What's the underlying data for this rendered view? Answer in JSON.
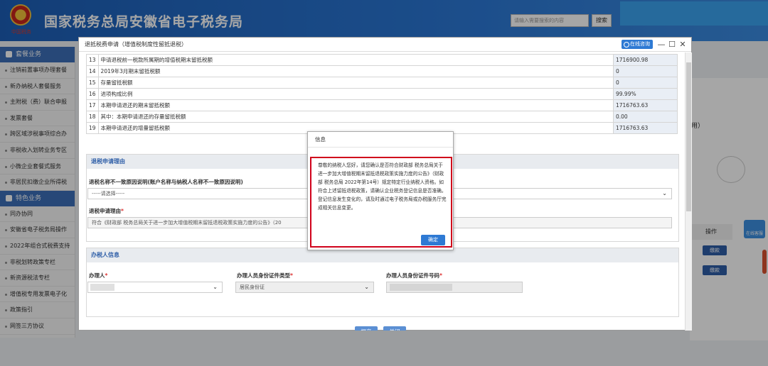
{
  "header": {
    "site_title": "国家税务总局安徽省电子税务局",
    "emblem_caption": "中国税务",
    "search_placeholder": "请输入需要搜索的内容",
    "search_label": "搜索"
  },
  "sidebar": {
    "section1": "套餐业务",
    "items1": [
      "注销前置事项办理套餐",
      "新办纳税人套餐服务",
      "主附税（费）联合申报",
      "发票套餐",
      "跨区域涉税事项综合办",
      "非税收入划转业务专区",
      "小微企业套餐式服务",
      "非居民扣缴企业所得税"
    ],
    "section2": "特色业务",
    "items2": [
      "同办协同",
      "安徽省电子税务局操作",
      "2022年组合式税费支持",
      "非税划转政策专栏",
      "新资源税法专栏",
      "增值税专用发票电子化",
      "政策指引",
      "网签三方协议"
    ]
  },
  "background": {
    "partial_text": "用）",
    "op_header": "操作",
    "pay_label": "缴款",
    "cs_label": "在线客服"
  },
  "modal": {
    "title": "退抵税费申请（增值税制度性留抵退税）",
    "online_label": "在线咨询",
    "minimize": "—",
    "maximize": "☐",
    "close": "✕",
    "rows": [
      {
        "no": "13",
        "label": "申请退税前一税款所属期的增值税期末留抵税额",
        "value": "1716900.98"
      },
      {
        "no": "14",
        "label": "2019年3月期末留抵税额",
        "value": "0"
      },
      {
        "no": "15",
        "label": "存量留抵税额",
        "value": "0"
      },
      {
        "no": "16",
        "label": "进项构成比例",
        "value": "99.99%"
      },
      {
        "no": "17",
        "label": "本期申请退还的期末留抵税额",
        "value": "1716763.63"
      },
      {
        "no": "18",
        "label": "其中：本期申请退还的存量留抵税额",
        "value": "0.00"
      },
      {
        "no": "19",
        "label": "本期申请退还的增量留抵税额",
        "value": "1716763.63"
      }
    ],
    "reason_section": "退税申请理由",
    "mismatch_label": "退税名称不一致原因说明(账户名称与纳税人名称不一致原因说明)",
    "select_placeholder": "-----请选择-----",
    "reason_label": "退税申请理由",
    "required": "*",
    "reason_value": "符合《财政部 税务总局关于进一步加大增值税期末留抵退税政策实施力度的公告》（20",
    "taxpayer_section": "办税人信息",
    "handler_label": "办理人",
    "id_type_label": "办理人员身份证件类型",
    "id_type_value": "居民身份证",
    "id_no_label": "办理人员身份证件号码",
    "submit": "提交",
    "close_btn": "关闭"
  },
  "dialog": {
    "title": "信息",
    "message": "尊敬的纳税人您好，请您确认是否符合财政部 税务总局关于进一步加大增值税期末留抵退税政策实施力度的公告》（财政部 税务总局 2022年第14号）规定特定行业纳税人资格。如符合上述留抵退税政策，请确认企业税务登记信息是否准确。登记信息发生变化的，请及时通过电子税务局或办税服务厅完成相关信息变更。",
    "ok": "确定"
  },
  "colors": {
    "header": "#2b78d6",
    "sidebar_head": "#3c6fb8",
    "highlight": "#d0021b"
  }
}
